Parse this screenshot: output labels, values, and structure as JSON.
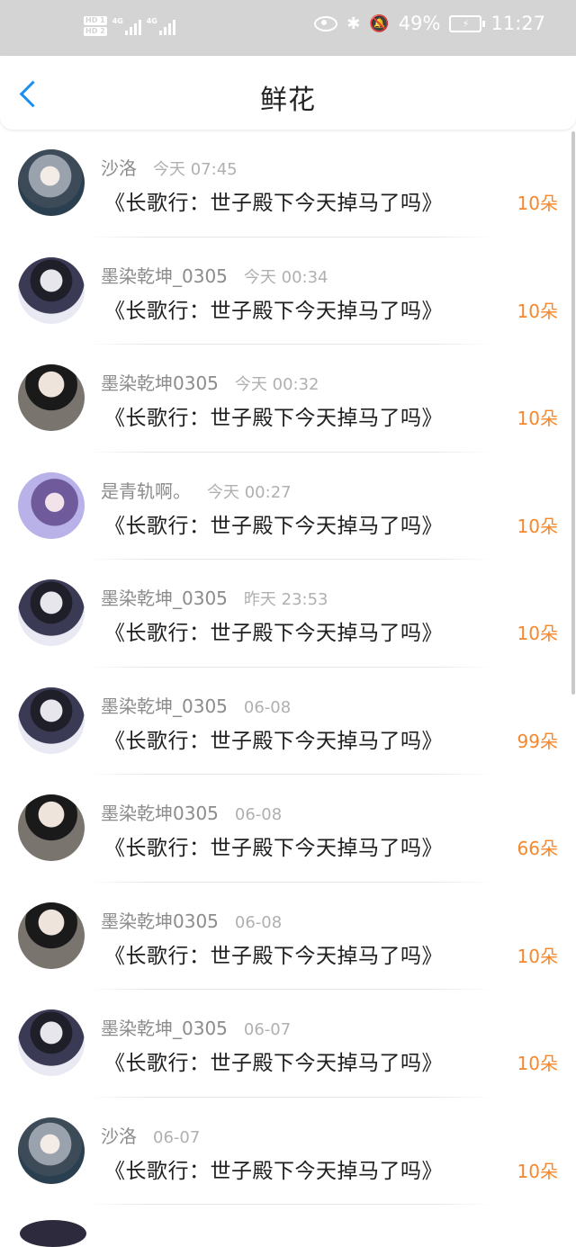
{
  "status_bar": {
    "hd1": "HD 1",
    "hd2": "HD 2",
    "net1": "4G",
    "net2": "4G",
    "battery_pct": "49%",
    "time": "11:27"
  },
  "header": {
    "title": "鲜花"
  },
  "items": [
    {
      "user": "沙洛",
      "time": "今天 07:45",
      "book": "《长歌行：世子殿下今天掉马了吗》",
      "flowers": "10朵",
      "avatar": "anime-avatar"
    },
    {
      "user": "墨染乾坤_0305",
      "time": "今天 00:34",
      "book": "《长歌行：世子殿下今天掉马了吗》",
      "flowers": "10朵",
      "avatar": "man-avatar"
    },
    {
      "user": "墨染乾坤0305",
      "time": "今天 00:32",
      "book": "《长歌行：世子殿下今天掉马了吗》",
      "flowers": "10朵",
      "avatar": "masked-avatar"
    },
    {
      "user": "是青轨啊。",
      "time": "今天 00:27",
      "book": "《长歌行：世子殿下今天掉马了吗》",
      "flowers": "10朵",
      "avatar": "girl-avatar"
    },
    {
      "user": "墨染乾坤_0305",
      "time": "昨天 23:53",
      "book": "《长歌行：世子殿下今天掉马了吗》",
      "flowers": "10朵",
      "avatar": "man-avatar"
    },
    {
      "user": "墨染乾坤_0305",
      "time": "06-08",
      "book": "《长歌行：世子殿下今天掉马了吗》",
      "flowers": "99朵",
      "avatar": "man-avatar"
    },
    {
      "user": "墨染乾坤0305",
      "time": "06-08",
      "book": "《长歌行：世子殿下今天掉马了吗》",
      "flowers": "66朵",
      "avatar": "masked-avatar"
    },
    {
      "user": "墨染乾坤0305",
      "time": "06-08",
      "book": "《长歌行：世子殿下今天掉马了吗》",
      "flowers": "10朵",
      "avatar": "masked-avatar"
    },
    {
      "user": "墨染乾坤_0305",
      "time": "06-07",
      "book": "《长歌行：世子殿下今天掉马了吗》",
      "flowers": "10朵",
      "avatar": "man-avatar"
    },
    {
      "user": "沙洛",
      "time": "06-07",
      "book": "《长歌行：世子殿下今天掉马了吗》",
      "flowers": "10朵",
      "avatar": "anime-avatar"
    }
  ],
  "colors": {
    "accent_blue": "#1a8ff0",
    "flower_orange": "#f5872d",
    "status_bar_bg": "#d4d4d4"
  }
}
